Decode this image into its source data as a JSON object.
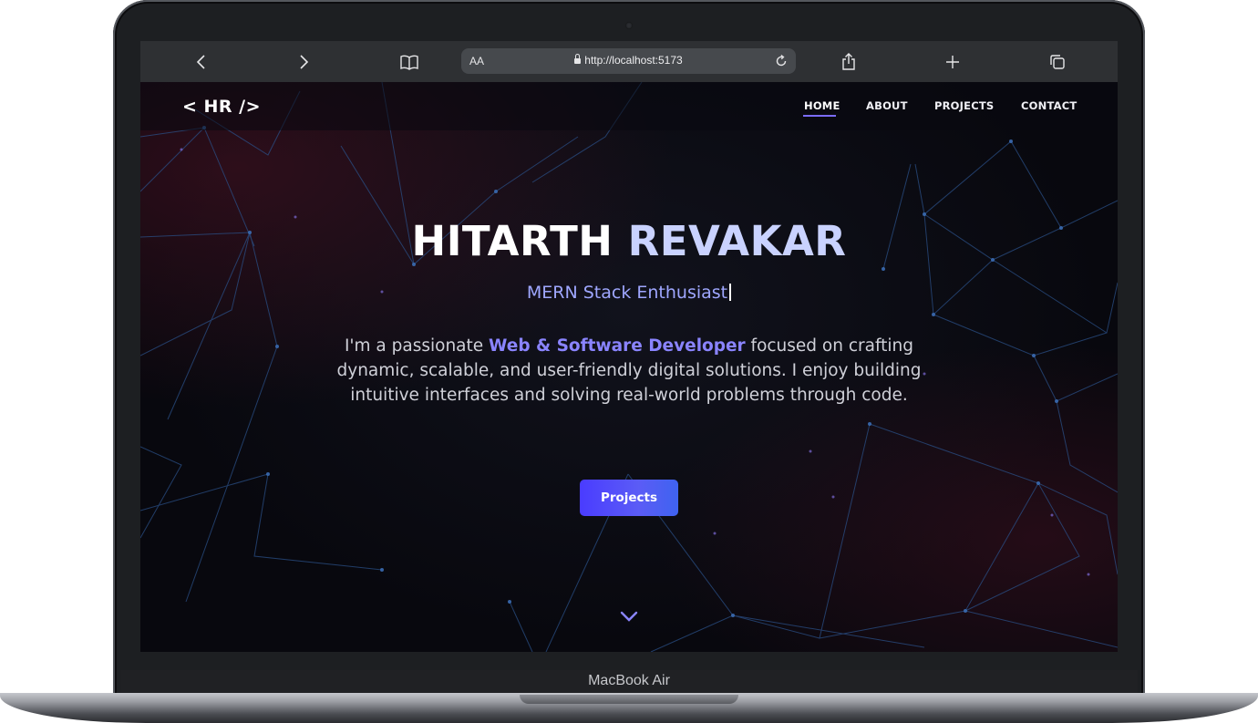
{
  "device": {
    "label": "MacBook Air"
  },
  "browser": {
    "url_aa": "AA",
    "url": "http://localhost:5173"
  },
  "site": {
    "logo": "< HR />",
    "nav": [
      {
        "label": "HOME",
        "active": true
      },
      {
        "label": "ABOUT",
        "active": false
      },
      {
        "label": "PROJECTS",
        "active": false
      },
      {
        "label": "CONTACT",
        "active": false
      }
    ],
    "hero": {
      "name_first": "HITARTH",
      "name_last": "REVAKAR",
      "subtitle": "MERN Stack Enthusiast",
      "desc_pre": "I'm a passionate ",
      "desc_highlight": "Web & Software Developer",
      "desc_post": " focused on crafting dynamic, scalable, and user-friendly digital solutions. I enjoy building intuitive interfaces and solving real-world problems through code.",
      "cta_label": "Projects"
    },
    "colors": {
      "accent": "#5b5cf6",
      "highlight": "#8a84ff",
      "background": "#08080e"
    }
  }
}
